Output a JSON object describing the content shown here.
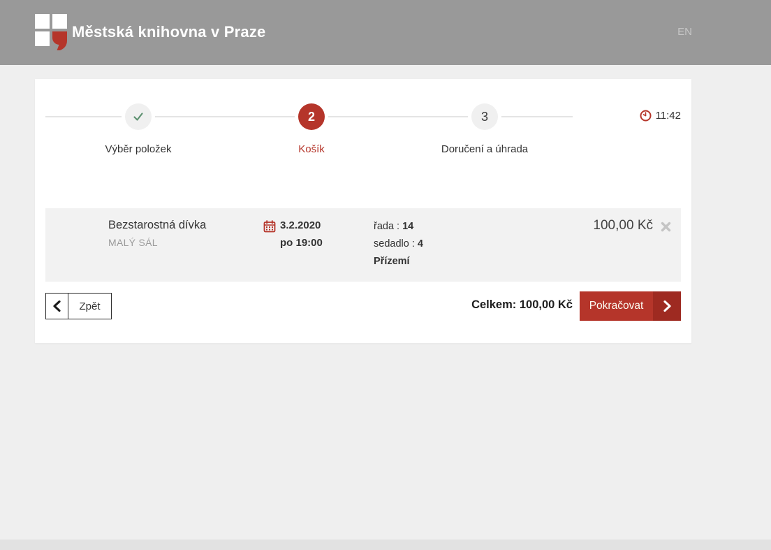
{
  "header": {
    "title": "Městská knihovna v Praze",
    "language_link": "EN"
  },
  "stepper": {
    "steps": [
      {
        "label": "Výběr položek",
        "indicator": "check",
        "state": "done"
      },
      {
        "label": "Košík",
        "indicator": "2",
        "state": "active"
      },
      {
        "label": "Doručení a úhrada",
        "indicator": "3",
        "state": "pending"
      }
    ],
    "timer": "11:42"
  },
  "cart": {
    "items": [
      {
        "title": "Bezstarostná dívka",
        "venue": "MALÝ SÁL",
        "date": "3.2.2020",
        "time": "po 19:00",
        "row_label": "řada : ",
        "row_value": "14",
        "seat_label": "sedadlo : ",
        "seat_value": "4",
        "floor": "Přízemí",
        "price": "100,00 Kč"
      }
    ]
  },
  "controls": {
    "back_label": "Zpět",
    "total_label": "Celkem: ",
    "total_value": "100,00 Kč",
    "continue_label": "Pokračovat"
  },
  "colors": {
    "accent_red": "#b5352a",
    "accent_red_dark": "#9e2a21",
    "check_green": "#5f9272",
    "header_gray": "#999999",
    "row_gray": "#f2f2f2",
    "page_bg": "#efefef"
  }
}
